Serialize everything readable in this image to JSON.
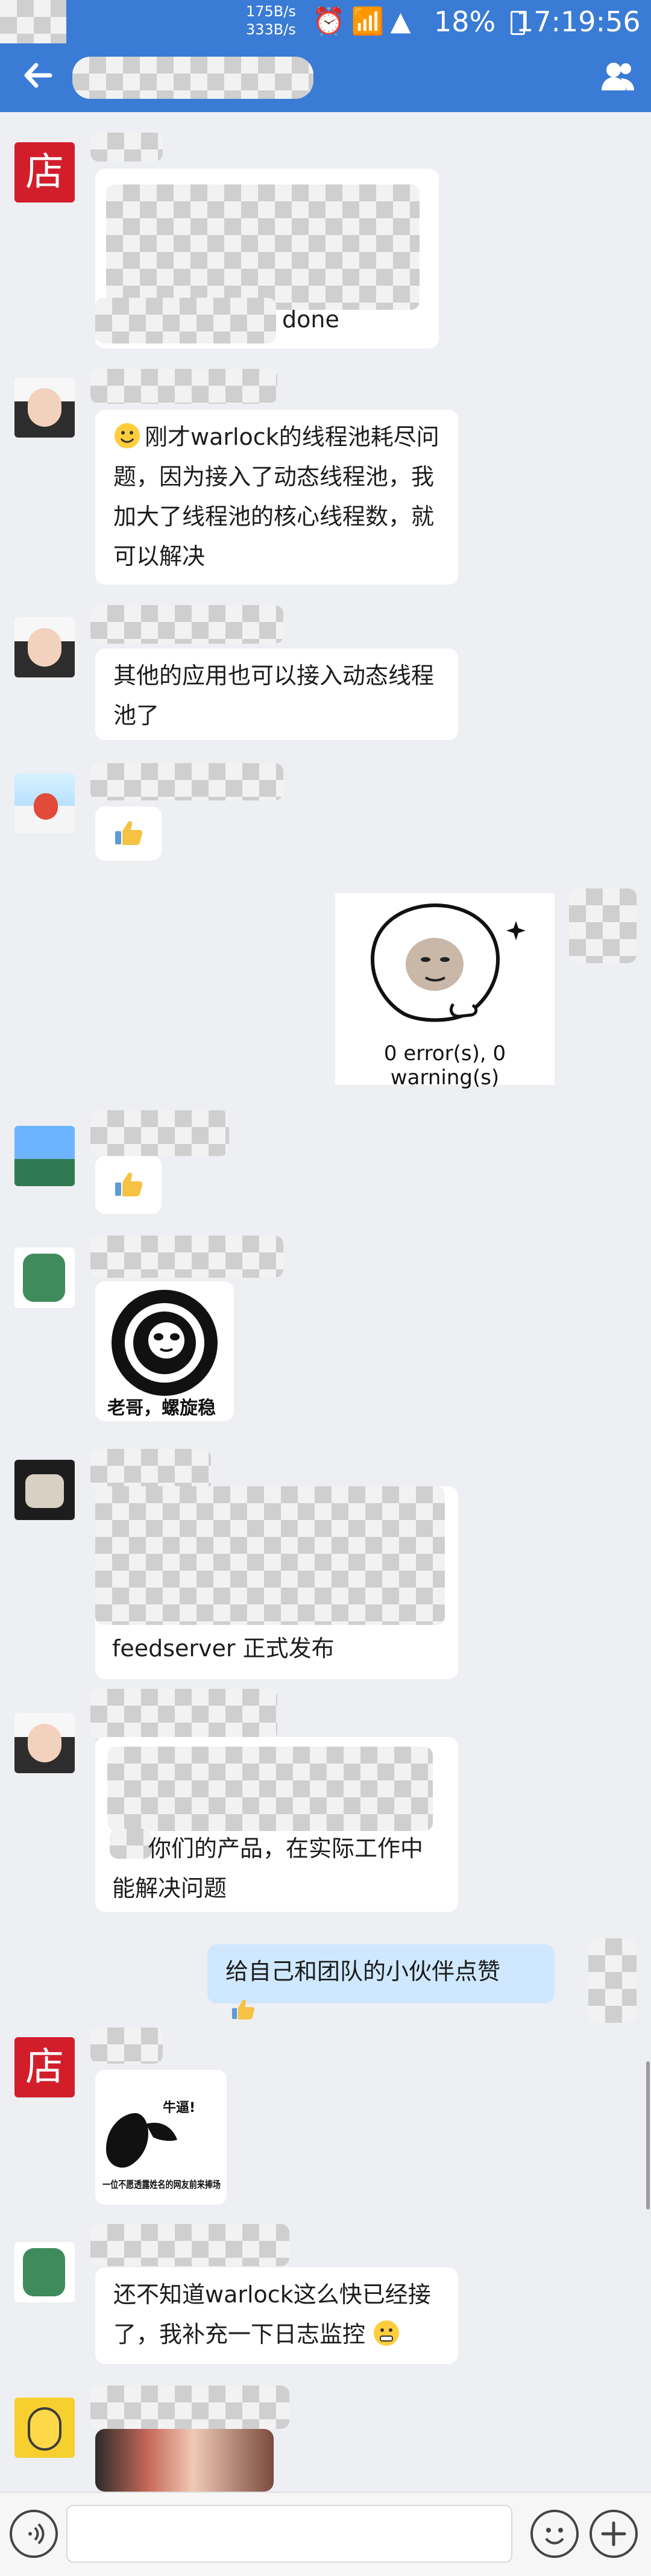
{
  "status_bar": {
    "net_speed_up": "175B/s",
    "net_speed_down": "333B/s",
    "battery": "18%",
    "time": "17:19:56"
  },
  "app_bar": {
    "title": ""
  },
  "messages": [
    {
      "id": 1,
      "text": "done"
    },
    {
      "id": 2,
      "text": "刚才warlock的线程池耗尽问题，因为接入了动态线程池，我加大了线程池的核心线程数，就可以解决"
    },
    {
      "id": 3,
      "text": "其他的应用也可以接入动态线程池了"
    },
    {
      "id": 4,
      "text": ""
    },
    {
      "id": 5,
      "text": "0 error(s), 0 warning(s)"
    },
    {
      "id": 6,
      "text": ""
    },
    {
      "id": 7,
      "text": "老哥，螺旋稳"
    },
    {
      "id": 8,
      "text": "feedserver 正式发布"
    },
    {
      "id": 9,
      "text": "你们的产品，在实际工作中能解决问题"
    },
    {
      "id": 10,
      "text": "给自己和团队的小伙伴点赞"
    },
    {
      "id": 11,
      "text": "牛逼!"
    },
    {
      "id": 12,
      "text": "一位不愿透露姓名的网友前来捧场"
    },
    {
      "id": 13,
      "text": "还不知道warlock这么快已经接了，我补充一下日志监控"
    }
  ],
  "avatars": [
    {
      "name": "店",
      "type": "store"
    },
    {
      "name": "",
      "type": "girl"
    },
    {
      "name": "",
      "type": "cartoon"
    },
    {
      "name": "",
      "type": "scenery"
    },
    {
      "name": "",
      "type": "dino"
    },
    {
      "name": "",
      "type": "cat"
    },
    {
      "name": "",
      "type": "minion"
    }
  ],
  "input": {
    "placeholder": ""
  },
  "colors": {
    "header_blue": "#3a7bd5",
    "bubble_mine": "#cfe8ff",
    "chat_bg": "#eeeff3"
  },
  "icons": {
    "back": "arrow-left-icon",
    "contacts": "people-icon",
    "voice": "voice-icon",
    "emoji": "smile-icon",
    "add": "plus-icon"
  }
}
